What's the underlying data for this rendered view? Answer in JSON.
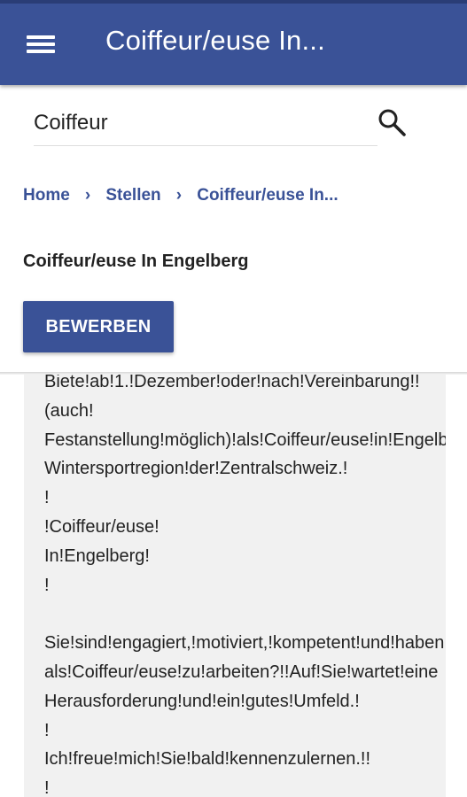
{
  "app_bar": {
    "title": "Coiffeur/euse In...",
    "menu_icon": "hamburger-menu-icon",
    "color": "#3a5297"
  },
  "search": {
    "value": "Coiffeur",
    "icon": "search-icon"
  },
  "breadcrumb": {
    "items": [
      "Home",
      "Stellen",
      "Coiffeur/euse In..."
    ],
    "separator": "›"
  },
  "job": {
    "title": "Coiffeur/euse In Engelberg",
    "apply_label": "BEWERBEN"
  },
  "document": {
    "background": "#f1f1f1",
    "lines": [
      "Biete!ab!1.!Dezember!oder!nach!Vereinbarung!!",
      "(auch!",
      "Festanstellung!möglich)!als!Coiffeur/euse!in!Engelberg,",
      "Wintersportregion!der!Zentralschweiz.!",
      "!",
      "!Coiffeur/euse!",
      "In!Engelberg!",
      "!",
      "",
      "Sie!sind!engagiert,!motiviert,!kompetent!und!haben!Lust",
      "als!Coiffeur/euse!zu!arbeiten?!!Auf!Sie!wartet!eine",
      "Herausforderung!und!ein!gutes!Umfeld.!",
      "!",
      "Ich!freue!mich!Sie!bald!kennenzulernen.!!",
      "!"
    ]
  }
}
